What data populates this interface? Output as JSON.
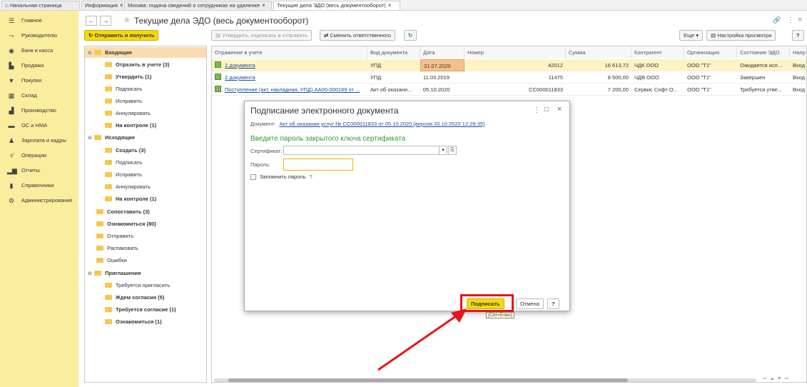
{
  "tabs": [
    {
      "label": "Начальная страница",
      "close": ""
    },
    {
      "label": "Информация",
      "close": "×"
    },
    {
      "label": "Москва: подача сведений о сотрудниках на удаленке",
      "close": "×"
    },
    {
      "label": "Текущие дела ЭДО (весь документооборот)",
      "close": "×"
    }
  ],
  "sidebar": {
    "items": [
      {
        "label": "Главное",
        "icon": "menu-icon"
      },
      {
        "label": "Руководителю",
        "icon": "chart-line-icon"
      },
      {
        "label": "Банк и касса",
        "icon": "bank-icon"
      },
      {
        "label": "Продажи",
        "icon": "cart-icon"
      },
      {
        "label": "Покупки",
        "icon": "purchase-icon"
      },
      {
        "label": "Склад",
        "icon": "warehouse-icon"
      },
      {
        "label": "Производство",
        "icon": "factory-icon"
      },
      {
        "label": "ОС и НМА",
        "icon": "truck-icon"
      },
      {
        "label": "Зарплата и кадры",
        "icon": "person-icon"
      },
      {
        "label": "Операции",
        "icon": "operations-icon"
      },
      {
        "label": "Отчеты",
        "icon": "bar-chart-icon"
      },
      {
        "label": "Справочники",
        "icon": "book-icon"
      },
      {
        "label": "Администрирование",
        "icon": "gear-icon"
      }
    ]
  },
  "header": {
    "back": "←",
    "forward": "→",
    "title": "Текущие дела ЭДО (весь документооборот)",
    "link_icon": "🔗",
    "more_icon": "⋮",
    "close_icon": "×"
  },
  "toolbar": {
    "send_receive": "Отправить и получить",
    "approve_sign_send": "Утвердить, подписать и отправить",
    "change_responsible": "Сменить ответственного",
    "more": "Еще",
    "view_settings": "Настройка просмотра",
    "help": "?"
  },
  "tree": {
    "incoming": "Входящие",
    "incoming_items": [
      "Отразить в учете (3)",
      "Утвердить (1)",
      "Подписать",
      "Исправить",
      "Аннулировать",
      "На контроле (1)"
    ],
    "outgoing": "Исходящие",
    "outgoing_items": [
      "Создать (3)",
      "Подписать",
      "Исправить",
      "Аннулировать",
      "На контроле (1)"
    ],
    "root_items": [
      "Сопоставить (3)",
      "Ознакомиться (80)",
      "Отправить",
      "Распаковать",
      "Ошибки"
    ],
    "invitations": "Приглашения",
    "invitation_items": [
      "Требуется пригласить",
      "Ждем согласия (5)",
      "Требуется согласие (1)",
      "Ознакомиться (1)"
    ]
  },
  "grid": {
    "columns": [
      "Отражение в учете",
      "Вид документа",
      "Дата",
      "Номер",
      "Сумма",
      "Контрагент",
      "Организация",
      "Состояние ЭДО",
      "Напр"
    ],
    "rows": [
      [
        "2 документа",
        "УПД",
        "31.07.2020",
        "42012",
        "16 613,72",
        "ЧДК ООО",
        "ООО \"Т1\"",
        "Ожидается исп...",
        "Вход"
      ],
      [
        "2 документа",
        "УПД",
        "11.03.2019",
        "11475",
        "8 500,00",
        "ЧДВ ООО",
        "ООО \"Т1\"",
        "Завершен",
        "Вход"
      ],
      [
        "Поступление (акт, накладная, УПД) АА00-000169 от ...",
        "Акт об оказани...",
        "05.10.2020",
        "СС000011833",
        "7 200,00",
        "Сервис Софт О...",
        "ООО \"Т1\"",
        "Требуется утве...",
        "Вход"
      ]
    ]
  },
  "dialog": {
    "title": "Подписание электронного документа",
    "doc_label": "Документ:",
    "doc_link": "Акт об оказании услуг № СС000011833  от 05.10.2020 (версия 20.10.2020 12:28:35)",
    "prompt": "Введите пароль закрытого ключа сертификата",
    "cert_label": "Сертификат:",
    "password_label": "Пароль:",
    "remember": "Запомнить пароль",
    "remember_help": "?",
    "sign_button": "Подписать",
    "cancel_button": "Отмена",
    "help_button": "?",
    "shortcut_hint": "(Ctrl+Enter)",
    "more_icon": "⋮",
    "maximize_icon": "□",
    "close_icon": "×"
  },
  "colors": {
    "sidebar_bg": "#fbed9e",
    "accent_yellow": "#f5d90e",
    "highlight_red": "#e8141b",
    "link_blue": "#1a4f9c",
    "prompt_green": "#2f9a3d",
    "row_highlight": "#fdf3c4",
    "selected_cell": "#f6c08b"
  }
}
